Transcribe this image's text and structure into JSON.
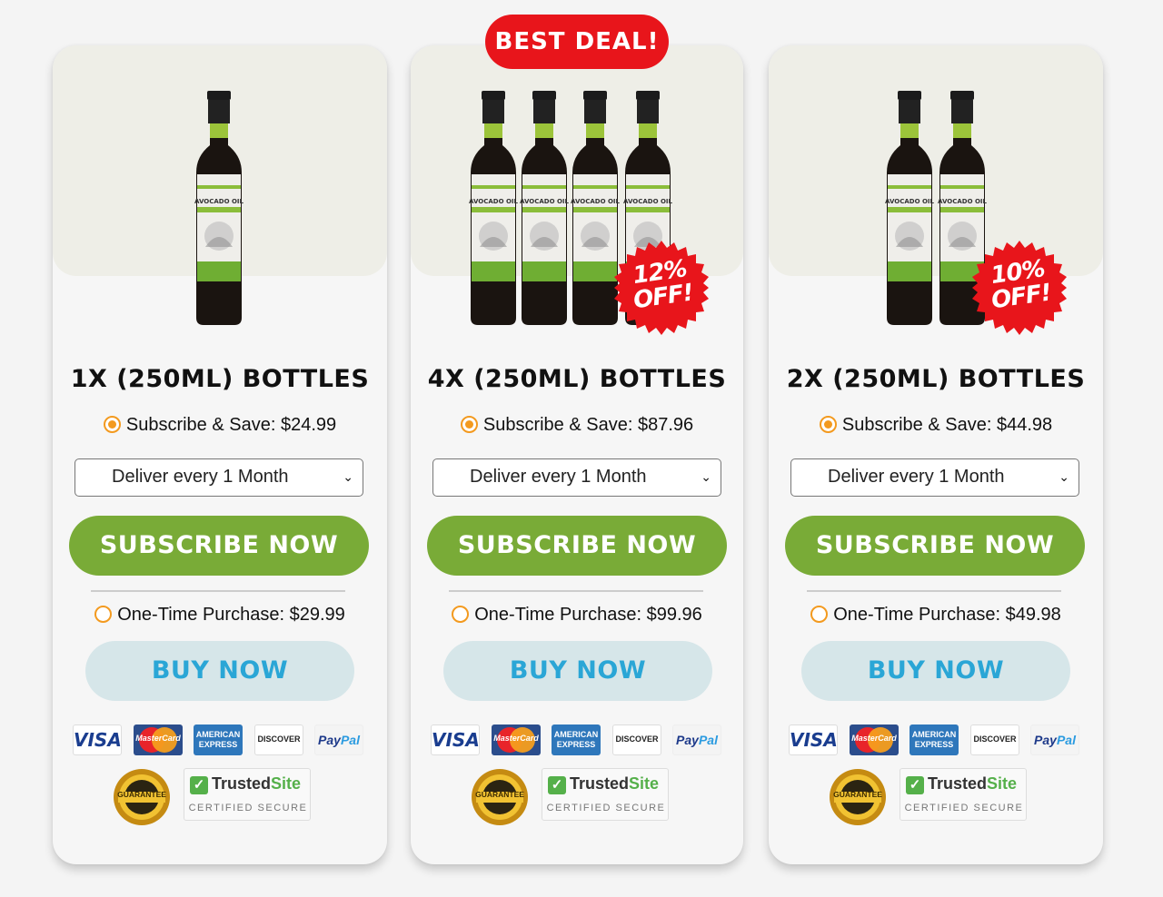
{
  "badge": {
    "best_deal": "BEST DEAL!"
  },
  "colors": {
    "subscribe_green": "#79ab37",
    "buy_button_bg": "#d6e6e9",
    "buy_text_blue": "#2aa6d6",
    "radio_orange": "#f39a1f",
    "badge_red": "#e8151b"
  },
  "bottle_label": {
    "brand_top": "100% AVOCADO OIL",
    "product": "AVOCADO OIL"
  },
  "cards": [
    {
      "title": "1X (250ML) BOTTLES",
      "bottle_count": 1,
      "discount": "",
      "subscribe_label": "Subscribe & Save: $24.99",
      "subscribe_selected": true,
      "delivery_select": "Deliver every 1 Month",
      "subscribe_button": "SUBSCRIBE NOW",
      "one_time_label": "One-Time Purchase: $29.99",
      "buy_button": "BUY NOW"
    },
    {
      "title": "4X (250ML) BOTTLES",
      "bottle_count": 4,
      "discount": "12% OFF!",
      "discount_line1": "12%",
      "discount_line2": "OFF!",
      "subscribe_label": "Subscribe & Save: $87.96",
      "subscribe_selected": true,
      "delivery_select": "Deliver every 1 Month",
      "subscribe_button": "SUBSCRIBE NOW",
      "one_time_label": "One-Time Purchase: $99.96",
      "buy_button": "BUY NOW"
    },
    {
      "title": "2X (250ML) BOTTLES",
      "bottle_count": 2,
      "discount": "10% OFF!",
      "discount_line1": "10%",
      "discount_line2": "OFF!",
      "subscribe_label": "Subscribe & Save: $44.98",
      "subscribe_selected": true,
      "delivery_select": "Deliver every 1 Month",
      "subscribe_button": "SUBSCRIBE NOW",
      "one_time_label": "One-Time Purchase: $49.98",
      "buy_button": "BUY NOW"
    }
  ],
  "payment_icons": [
    "visa-icon",
    "mastercard-icon",
    "american-express-icon",
    "discover-icon",
    "paypal-icon"
  ],
  "payment_labels": {
    "visa": "VISA",
    "mastercard": "MasterCard",
    "amex_line1": "AMERICAN",
    "amex_line2": "EXPRESS",
    "discover": "DISCOVER",
    "paypal_pay": "Pay",
    "paypal_pal": "Pal"
  },
  "trust": {
    "guarantee": "GUARANTEE",
    "trusted_name": "Trusted",
    "trusted_site": "Site",
    "certified": "CERTIFIED SECURE"
  }
}
